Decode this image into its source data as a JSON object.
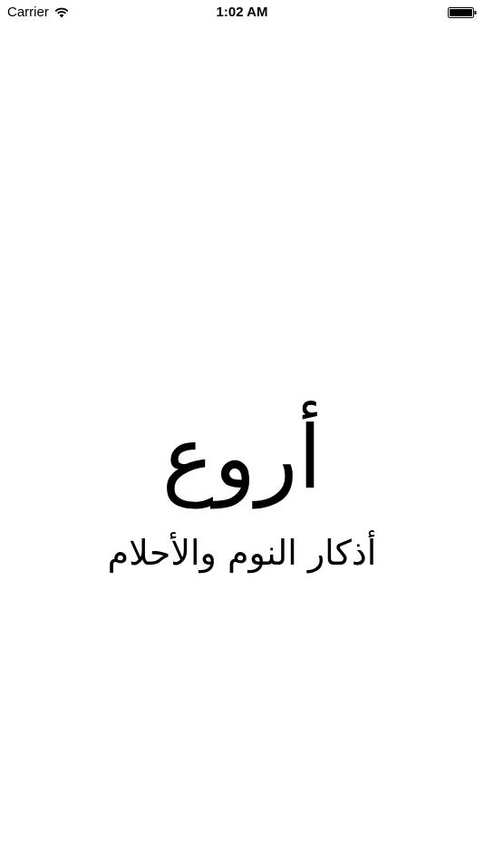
{
  "status_bar": {
    "carrier": "Carrier",
    "time": "1:02 AM",
    "wifi_icon": "wifi-icon",
    "battery_icon": "battery-icon"
  },
  "splash": {
    "brand": "أروع",
    "subtitle": "أذكار النوم والأحلام"
  },
  "colors": {
    "background": "#ffffff",
    "text": "#000000"
  }
}
